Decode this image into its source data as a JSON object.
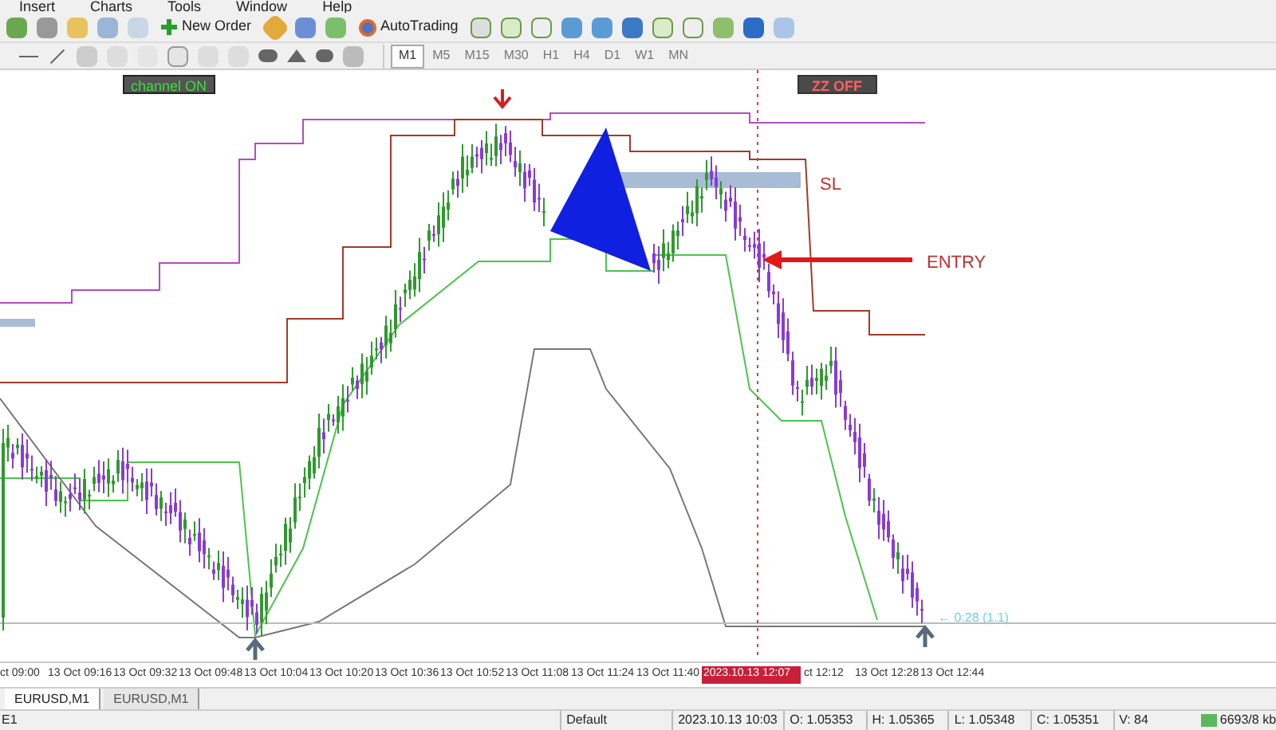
{
  "menu": [
    {
      "label": "Insert"
    },
    {
      "label": "Charts"
    },
    {
      "label": "Tools"
    },
    {
      "label": "Window"
    },
    {
      "label": "Help"
    }
  ],
  "toolbar": {
    "new_order": "New Order",
    "auto_trading": "AutoTrading"
  },
  "timeframes": [
    {
      "label": "M1",
      "selected": true
    },
    {
      "label": "M5",
      "selected": false
    },
    {
      "label": "M15",
      "selected": false
    },
    {
      "label": "M30",
      "selected": false
    },
    {
      "label": "H1",
      "selected": false
    },
    {
      "label": "H4",
      "selected": false
    },
    {
      "label": "D1",
      "selected": false
    },
    {
      "label": "W1",
      "selected": false
    },
    {
      "label": "MN",
      "selected": false
    }
  ],
  "chart": {
    "channel_badge": "channel ON",
    "zigzag_badge": "ZZ OFF",
    "sl_label": "SL",
    "entry_label": "ENTRY",
    "countdown": "← 0:28 (1.1)"
  },
  "time_axis": {
    "labels_before": [
      "ct 09:00",
      "13 Oct 09:16",
      "13 Oct 09:32",
      "13 Oct 09:48",
      "13 Oct 10:04",
      "13 Oct 10:20",
      "13 Oct 10:36",
      "13 Oct 10:52",
      "13 Oct 11:08",
      "13 Oct 11:24",
      "13 Oct 11:40"
    ],
    "cursor_label": "2023.10.13 12:07",
    "labels_after": [
      "ct 12:12",
      "13 Oct 12:28",
      "13 Oct 12:44"
    ]
  },
  "tabs": [
    {
      "label": "EURUSD,M1",
      "selected": true
    },
    {
      "label": "EURUSD,M1",
      "selected": false
    }
  ],
  "status_bar": {
    "left": "E1",
    "fields": [
      "Default",
      "2023.10.13 10:03",
      "O: 1.05353",
      "H: 1.05365",
      "L: 1.05348",
      "C: 1.05351",
      "V: 84"
    ],
    "memory": "6693/8 kb"
  }
}
